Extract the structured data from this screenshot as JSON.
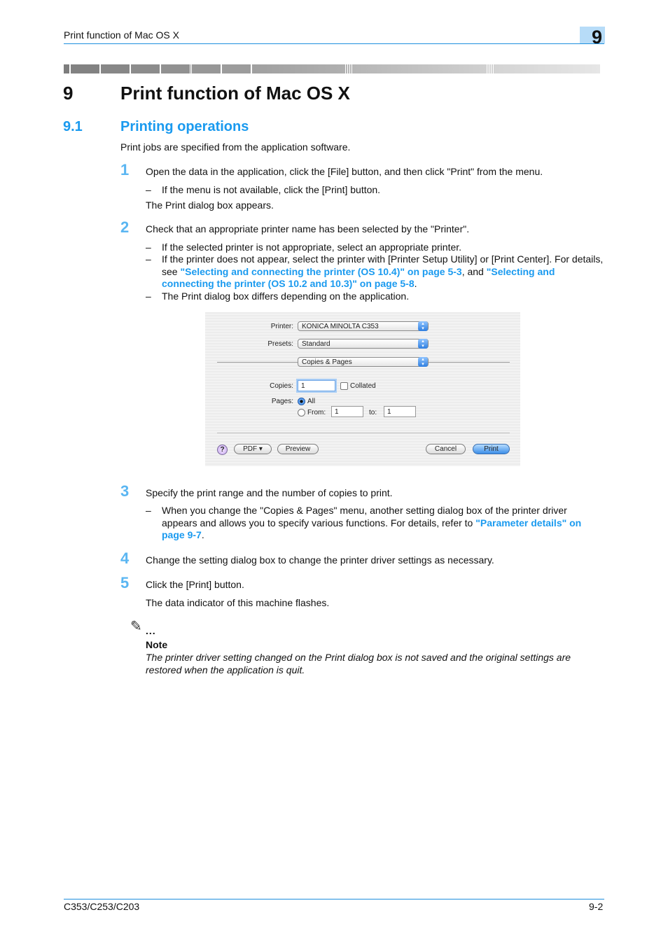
{
  "header": {
    "running_title": "Print function of Mac OS X",
    "chapter_badge": "9"
  },
  "chapter": {
    "number": "9",
    "title": "Print function of Mac OS X"
  },
  "section": {
    "number": "9.1",
    "title": "Printing operations"
  },
  "intro": "Print jobs are specified from the application software.",
  "steps": [
    {
      "num": "1",
      "text": "Open the data in the application, click the [File] button, and then click \"Print\" from the menu.",
      "bullets": [
        "If the menu is not available, click the [Print] button."
      ],
      "result": "The Print dialog box appears."
    },
    {
      "num": "2",
      "text": "Check that an appropriate printer name has been selected by the \"Printer\".",
      "bullets": [
        "If the selected printer is not appropriate, select an appropriate printer.",
        "The Print dialog box differs depending on the application."
      ],
      "bullet2_pre": "If the printer does not appear, select the printer with [Printer Setup Utility] or [Print Center]. For details, see ",
      "bullet2_link1": "\"Selecting and connecting the printer (OS 10.4)\" on page 5-3",
      "bullet2_mid": ", and ",
      "bullet2_link2a": "\"Selecting and",
      "bullet2_link2b": "connecting the printer (OS 10.2 and 10.3)\" on page 5-8",
      "bullet2_end": "."
    },
    {
      "num": "3",
      "text": "Specify the print range and the number of copies to print.",
      "bullet_pre": "When you change the \"Copies & Pages\" menu, another setting dialog box of the printer driver appears and allows you to specify various functions. For details, refer to ",
      "bullet_link": "\"Parameter details\" on page 9-7",
      "bullet_end": "."
    },
    {
      "num": "4",
      "text": "Change the setting dialog box to change the printer driver settings as necessary."
    },
    {
      "num": "5",
      "text": "Click the [Print] button.",
      "result": "The data indicator of this machine flashes."
    }
  ],
  "note": {
    "icon": "pencil-note-icon",
    "dots": "...",
    "title": "Note",
    "text": "The printer driver setting changed on the Print dialog box is not saved and the original settings are restored when the application is quit."
  },
  "dialog": {
    "printer_label": "Printer:",
    "printer_value": "KONICA MINOLTA C353",
    "presets_label": "Presets:",
    "presets_value": "Standard",
    "panel_value": "Copies & Pages",
    "copies_label": "Copies:",
    "copies_value": "1",
    "collated_label": "Collated",
    "collated_checked": false,
    "pages_label": "Pages:",
    "all_label": "All",
    "all_selected": true,
    "from_label": "From:",
    "from_value": "1",
    "to_label": "to:",
    "to_value": "1",
    "help_label": "?",
    "pdf_label": "PDF ▾",
    "preview_label": "Preview",
    "cancel_label": "Cancel",
    "print_label": "Print"
  },
  "footer": {
    "model": "C353/C253/C203",
    "page": "9-2"
  },
  "colors": {
    "accent": "#1a9aef",
    "rule": "#1e8fde",
    "badge_bg": "#b7dcf8",
    "step_num": "#5ab6f2"
  }
}
